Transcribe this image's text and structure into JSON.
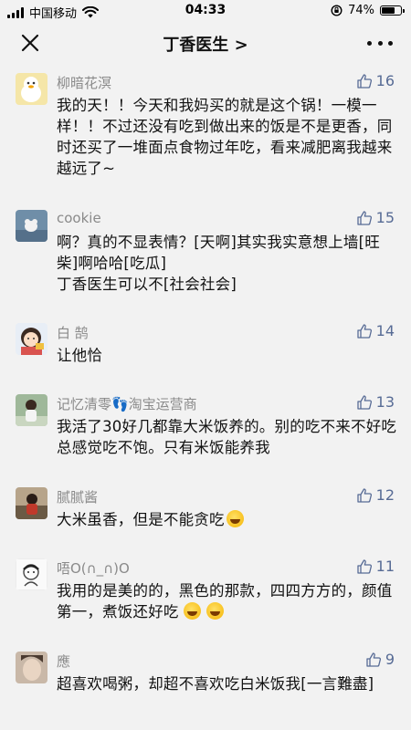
{
  "status_bar": {
    "carrier": "中国移动",
    "time": "04:33",
    "battery": "74%",
    "battery_level": 0.74
  },
  "nav": {
    "title": "丁香医生 >"
  },
  "comments": [
    {
      "username": "柳暗花溟",
      "likes": "16",
      "text": "我的天！！今天和我妈买的就是这个锅！一模一样！！不过还没有吃到做出来的饭是不是更香，同时还买了一堆面点食物过年吃，看来减肥离我越来越远了~"
    },
    {
      "username": "cookie",
      "likes": "15",
      "text": "啊？真的不显表情？[天啊]其实我实意想上墙[旺柴]啊哈哈[吃瓜]\n丁香医生可以不[社会社会]"
    },
    {
      "username": "白 鹄",
      "likes": "14",
      "text": "让他恰"
    },
    {
      "username": "记忆清零👣淘宝运营商",
      "likes": "13",
      "text": "我活了30好几都靠大米饭养的。别的吃不来不好吃总感觉吃不饱。只有米饭能养我"
    },
    {
      "username": "腻腻酱",
      "likes": "12",
      "text": "大米虽香，但是不能贪吃"
    },
    {
      "username": "唔O(∩_∩)O",
      "likes": "11",
      "text": "我用的是美的的，黑色的那款，四四方方的，颜值第一，煮饭还好吃"
    },
    {
      "username": "應",
      "likes": "9",
      "text": "超喜欢喝粥，却超不喜欢吃白米饭我[一言難盡]"
    }
  ],
  "colors": {
    "background": "#f2f2f2",
    "link_blue": "#576b95",
    "username_gray": "#8a8a8a"
  }
}
